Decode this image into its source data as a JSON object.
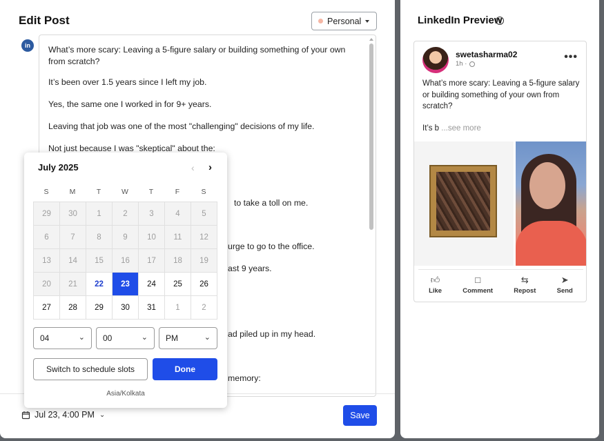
{
  "editor": {
    "title": "Edit Post",
    "account_select": "Personal",
    "network_badge": "in",
    "paragraphs": [
      "What’s more scary: Leaving a 5-figure salary or building something of your own from scratch?",
      "It’s been over 1.5 years since I left my job.",
      "Yes, the same one I worked in for 9+ years.",
      "Leaving that job was one of the most \"challenging\" decisions of my life.",
      "Not just because I was \"skeptical\" about the:"
    ],
    "partial_lines": [
      "to take a toll on me.",
      "urge to go to the office.",
      "ast 9 years.",
      "ad piled up in my head.",
      "memory:"
    ],
    "schedule_label": "Jul 23, 4:00 PM",
    "save_label": "Save"
  },
  "date_picker": {
    "month_label": "July 2025",
    "weekdays": [
      "S",
      "M",
      "T",
      "W",
      "T",
      "F",
      "S"
    ],
    "days": [
      {
        "d": "29",
        "s": "disabled"
      },
      {
        "d": "30",
        "s": "disabled"
      },
      {
        "d": "1",
        "s": "disabled"
      },
      {
        "d": "2",
        "s": "disabled"
      },
      {
        "d": "3",
        "s": "disabled"
      },
      {
        "d": "4",
        "s": "disabled"
      },
      {
        "d": "5",
        "s": "disabled"
      },
      {
        "d": "6",
        "s": "disabled"
      },
      {
        "d": "7",
        "s": "disabled"
      },
      {
        "d": "8",
        "s": "disabled"
      },
      {
        "d": "9",
        "s": "disabled"
      },
      {
        "d": "10",
        "s": "disabled"
      },
      {
        "d": "11",
        "s": "disabled"
      },
      {
        "d": "12",
        "s": "disabled"
      },
      {
        "d": "13",
        "s": "disabled"
      },
      {
        "d": "14",
        "s": "disabled"
      },
      {
        "d": "15",
        "s": "disabled"
      },
      {
        "d": "16",
        "s": "disabled"
      },
      {
        "d": "17",
        "s": "disabled"
      },
      {
        "d": "18",
        "s": "disabled"
      },
      {
        "d": "19",
        "s": "disabled"
      },
      {
        "d": "20",
        "s": "disabled"
      },
      {
        "d": "21",
        "s": "disabled"
      },
      {
        "d": "22",
        "s": "today"
      },
      {
        "d": "23",
        "s": "selected"
      },
      {
        "d": "24",
        "s": ""
      },
      {
        "d": "25",
        "s": ""
      },
      {
        "d": "26",
        "s": ""
      },
      {
        "d": "27",
        "s": ""
      },
      {
        "d": "28",
        "s": ""
      },
      {
        "d": "29",
        "s": ""
      },
      {
        "d": "30",
        "s": ""
      },
      {
        "d": "31",
        "s": ""
      },
      {
        "d": "1",
        "s": "next-month"
      },
      {
        "d": "2",
        "s": "next-month"
      }
    ],
    "hour": "04",
    "minute": "00",
    "ampm": "PM",
    "switch_label": "Switch to schedule slots",
    "done_label": "Done",
    "timezone": "Asia/Kolkata"
  },
  "preview": {
    "title": "LinkedIn Preview",
    "username": "swetasharma02",
    "time": "1h ·",
    "post_text": "What’s more scary: Leaving a 5-figure salary or building something of your own from scratch?",
    "snippet": "It’s b",
    "see_more": "...see more",
    "actions": [
      {
        "icon": "like-icon",
        "label": "Like"
      },
      {
        "icon": "comment-icon",
        "label": "Comment"
      },
      {
        "icon": "repost-icon",
        "label": "Repost"
      },
      {
        "icon": "send-icon",
        "label": "Send"
      }
    ]
  },
  "colors": {
    "accent": "#1f4de8",
    "disabled_cell": "#f3f3f3",
    "backdrop": "#5f6368"
  }
}
